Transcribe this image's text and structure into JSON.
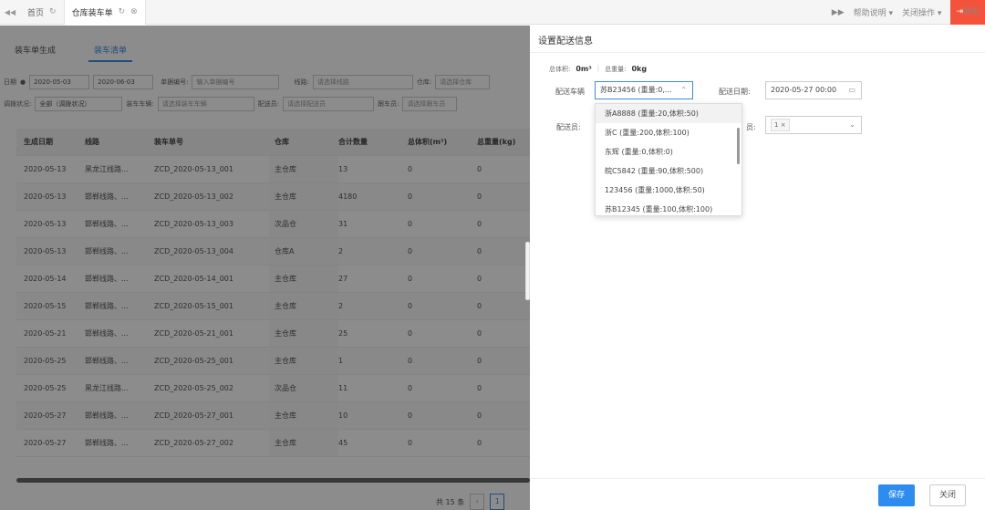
{
  "topbar": {
    "tabs": [
      {
        "label": "首页"
      },
      {
        "label": "仓库装车单"
      }
    ],
    "help": "帮助说明",
    "close_ops": "关闭操作",
    "logout": "退出"
  },
  "left": {
    "subtabs": [
      "装车单生成",
      "装车清单"
    ],
    "filters": {
      "date_label": "日期",
      "date_from": "2020-05-03",
      "date_to": "2020-06-03",
      "orderno_label": "单据编号:",
      "orderno_placeholder": "输入单据编号",
      "route_label": "线路:",
      "route_placeholder": "请选择线路",
      "warehouse_label": "仓库:",
      "warehouse_placeholder": "请选择仓库",
      "dispatch_label": "调拨状况:",
      "dispatch_value": "全部（调拨状况）",
      "vehicle_label": "装车车辆:",
      "vehicle_placeholder": "请选择装车车辆",
      "courier_label": "配送员:",
      "courier_placeholder": "请选择配送员",
      "follower_label": "跟车员:",
      "follower_placeholder": "请选择跟车员"
    },
    "table": {
      "headers": [
        "生成日期",
        "线路",
        "装车单号",
        "仓库",
        "合计数量",
        "总体积(m³)",
        "总重量(kg)"
      ],
      "rows": [
        [
          "2020-05-13",
          "黑龙江线路...",
          "ZCD_2020-05-13_001",
          "主仓库",
          "13",
          "0",
          "0"
        ],
        [
          "2020-05-13",
          "邯郸线路、...",
          "ZCD_2020-05-13_002",
          "主仓库",
          "4180",
          "0",
          "0"
        ],
        [
          "2020-05-13",
          "邯郸线路、...",
          "ZCD_2020-05-13_003",
          "次品仓",
          "31",
          "0",
          "0"
        ],
        [
          "2020-05-13",
          "邯郸线路、...",
          "ZCD_2020-05-13_004",
          "仓库A",
          "2",
          "0",
          "0"
        ],
        [
          "2020-05-14",
          "邯郸线路、...",
          "ZCD_2020-05-14_001",
          "主仓库",
          "27",
          "0",
          "0"
        ],
        [
          "2020-05-15",
          "邯郸线路、...",
          "ZCD_2020-05-15_001",
          "主仓库",
          "2",
          "0",
          "0"
        ],
        [
          "2020-05-21",
          "邯郸线路、...",
          "ZCD_2020-05-21_001",
          "主仓库",
          "25",
          "0",
          "0"
        ],
        [
          "2020-05-25",
          "邯郸线路、...",
          "ZCD_2020-05-25_001",
          "主仓库",
          "1",
          "0",
          "0"
        ],
        [
          "2020-05-25",
          "黑龙江线路...",
          "ZCD_2020-05-25_002",
          "次品仓",
          "11",
          "0",
          "0"
        ],
        [
          "2020-05-27",
          "邯郸线路、...",
          "ZCD_2020-05-27_001",
          "主仓库",
          "10",
          "0",
          "0"
        ],
        [
          "2020-05-27",
          "邯郸线路、...",
          "ZCD_2020-05-27_002",
          "主仓库",
          "45",
          "0",
          "0"
        ]
      ]
    },
    "pager": {
      "total": "共 15 条",
      "current": "1"
    }
  },
  "panel": {
    "title": "设置配送信息",
    "volume_label": "总体积:",
    "volume_value": "0m³",
    "weight_label": "总重量:",
    "weight_value": "0kg",
    "vehicle_label": "配送车辆",
    "vehicle_value": "苏B23456 (重量:0,...",
    "date_label": "配送日期:",
    "date_value": "2020-05-27 00:00",
    "courier_label": "配送员:",
    "follower_label_part": "员:",
    "follower_tag": "1",
    "options": [
      "浙A8888 (重量:20,体积:50)",
      "浙C (重量:200,体积:100)",
      "东辉 (重量:0,体积:0)",
      "皖C5842 (重量:90,体积:500)",
      "123456 (重量:1000,体积:50)",
      "苏B12345 (重量:100,体积:100)"
    ],
    "save": "保存",
    "close": "关闭"
  }
}
